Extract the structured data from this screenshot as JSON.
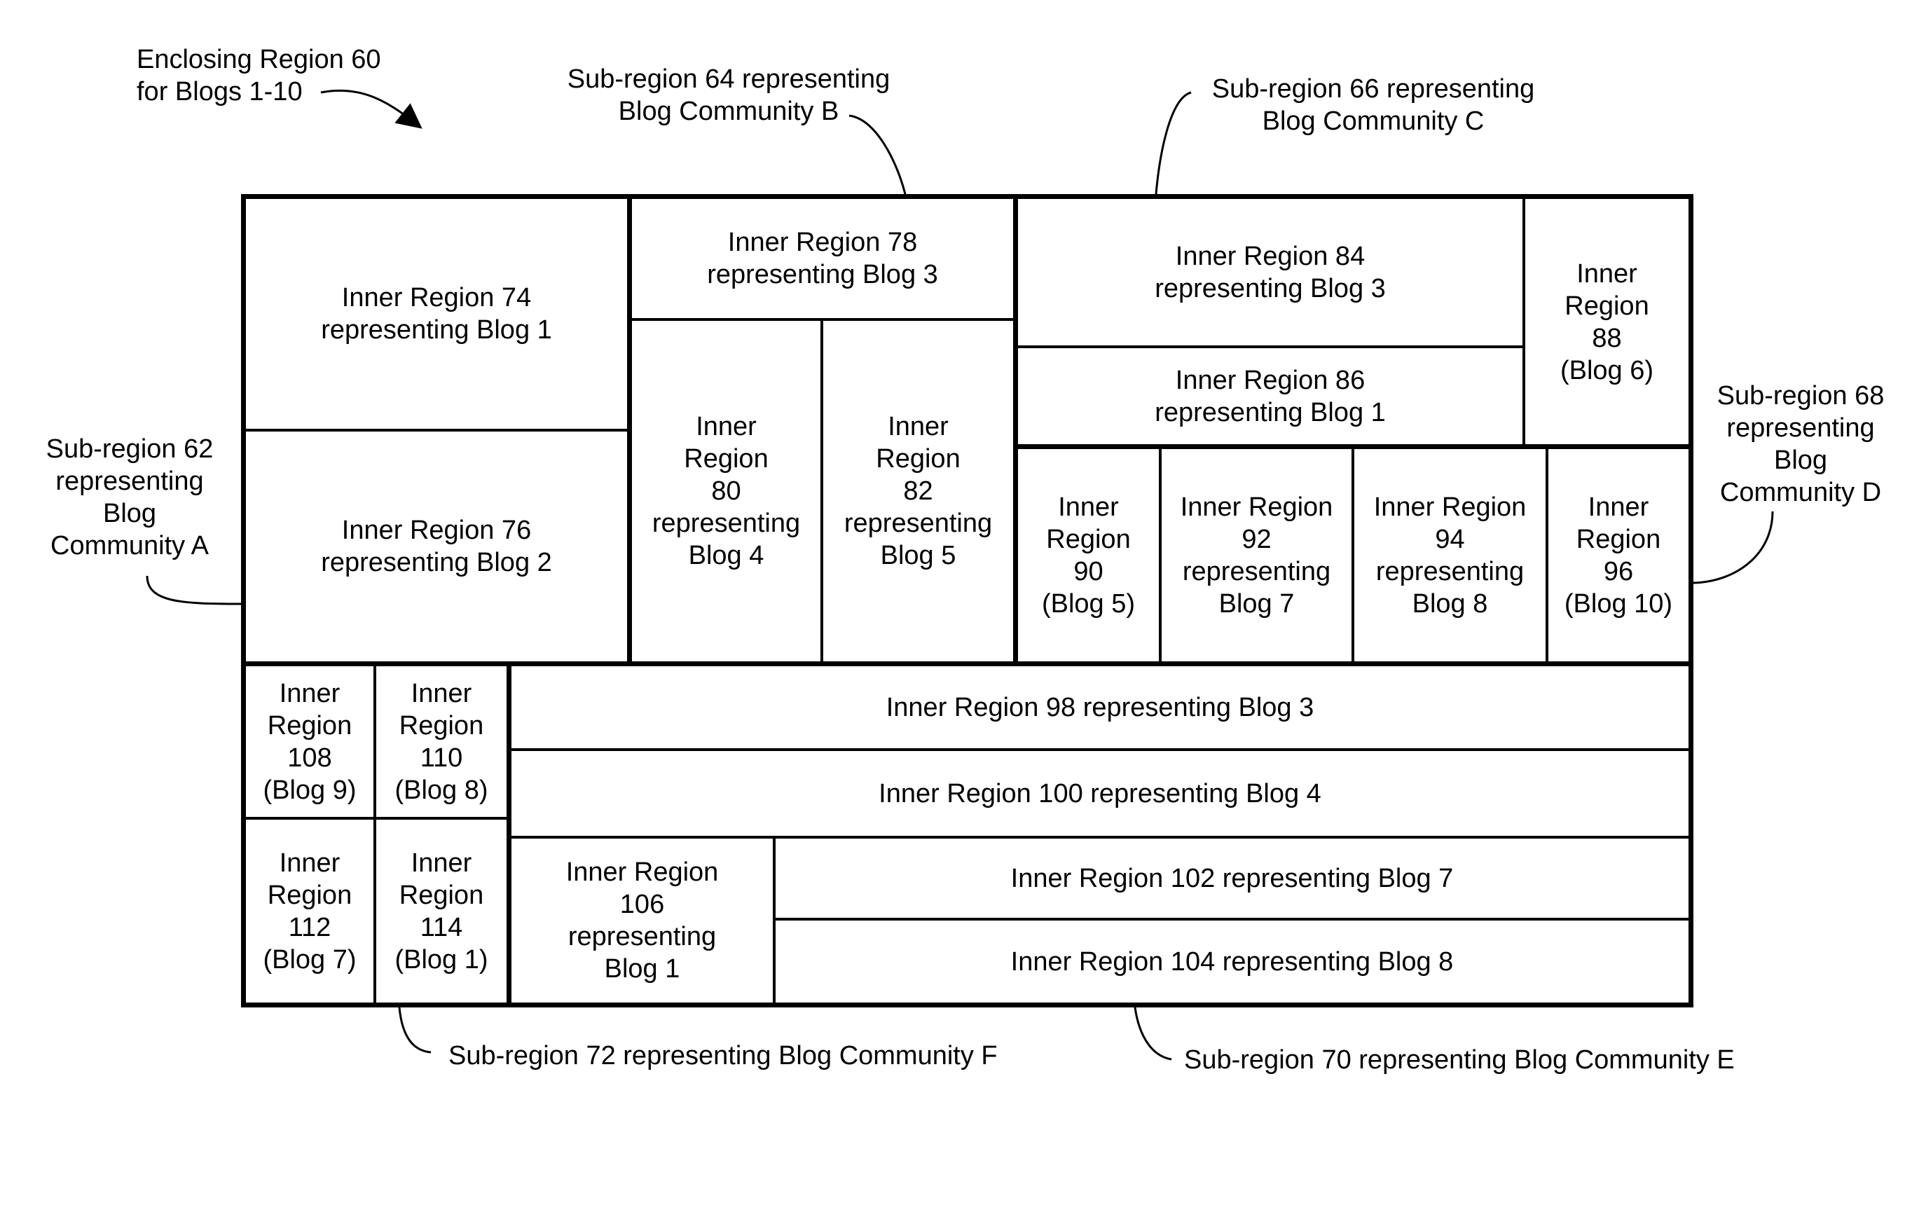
{
  "diagram": {
    "enclosing_label": "Enclosing Region 60\nfor Blogs 1-10",
    "subregions": {
      "a": "Sub-region 62\nrepresenting\nBlog\nCommunity A",
      "b": "Sub-region 64 representing\nBlog Community B",
      "c": "Sub-region 66 representing\nBlog Community C",
      "d": "Sub-region 68\nrepresenting\nBlog\nCommunity D",
      "e": "Sub-region 70 representing Blog Community E",
      "f": "Sub-region 72 representing Blog Community F"
    },
    "inner": {
      "r74": "Inner Region 74\nrepresenting Blog 1",
      "r76": "Inner Region 76\nrepresenting Blog 2",
      "r78": "Inner Region 78\nrepresenting Blog 3",
      "r80": "Inner\nRegion\n80\nrepresenting\nBlog 4",
      "r82": "Inner\nRegion\n82\nrepresenting\nBlog 5",
      "r84": "Inner Region 84\nrepresenting Blog 3",
      "r86": "Inner Region 86\nrepresenting Blog 1",
      "r88": "Inner\nRegion\n88\n(Blog 6)",
      "r90": "Inner\nRegion\n90\n(Blog 5)",
      "r92": "Inner Region\n92\nrepresenting\nBlog 7",
      "r94": "Inner Region\n94\nrepresenting\nBlog 8",
      "r96": "Inner\nRegion\n96\n(Blog 10)",
      "r98": "Inner Region 98 representing Blog 3",
      "r100": "Inner Region 100 representing Blog 4",
      "r102": "Inner Region 102 representing Blog 7",
      "r104": "Inner Region 104 representing Blog 8",
      "r106": "Inner Region\n106\nrepresenting\nBlog 1",
      "r108": "Inner\nRegion\n108\n(Blog 9)",
      "r110": "Inner\nRegion\n110\n(Blog 8)",
      "r112": "Inner\nRegion\n112\n(Blog 7)",
      "r114": "Inner\nRegion\n114\n(Blog 1)"
    }
  }
}
